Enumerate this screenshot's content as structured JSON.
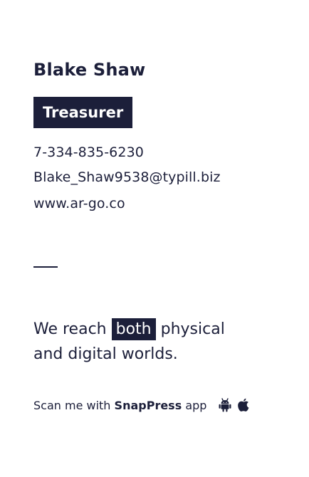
{
  "card": {
    "name": "Blake Shaw",
    "role": "Treasurer",
    "phone": "7-334-835-6230",
    "email": "Blake_Shaw9538@typill.biz",
    "website": "www.ar-go.co",
    "tagline": {
      "before": "We reach",
      "highlight": "both",
      "after": "physical",
      "line2": "and digital worlds."
    },
    "scan": {
      "prefix": "Scan me with",
      "brand": "SnapPress",
      "suffix": "app"
    },
    "icons": [
      "android-icon",
      "apple-icon"
    ],
    "colors": {
      "ink": "#1c1f3a",
      "background": "#ffffff"
    }
  }
}
